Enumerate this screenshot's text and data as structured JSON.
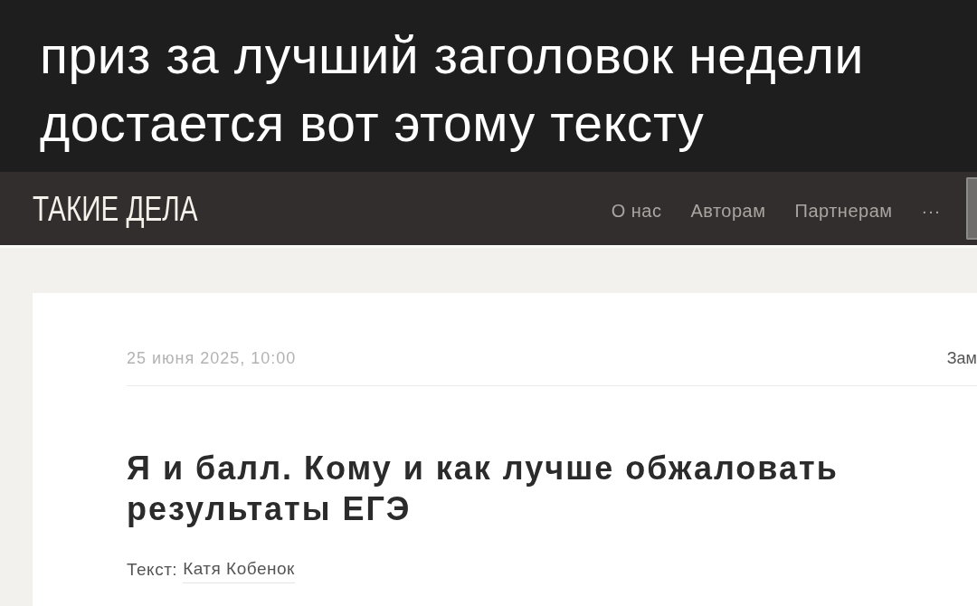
{
  "caption": {
    "lines": [
      "приз за лучший заголовок недели",
      "достается вот этому тексту"
    ]
  },
  "header": {
    "logo": "ТАКИЕ ДЕЛА",
    "nav": [
      {
        "label": "О нас"
      },
      {
        "label": "Авторам"
      },
      {
        "label": "Партнерам"
      },
      {
        "label": "···"
      }
    ]
  },
  "article": {
    "date": "25 июня 2025, 10:00",
    "side_link": "Зам",
    "title": "Я и балл. Кому и как лучше обжаловать результаты ЕГЭ",
    "byline_label": "Текст:",
    "author": "Катя Кобенок"
  }
}
